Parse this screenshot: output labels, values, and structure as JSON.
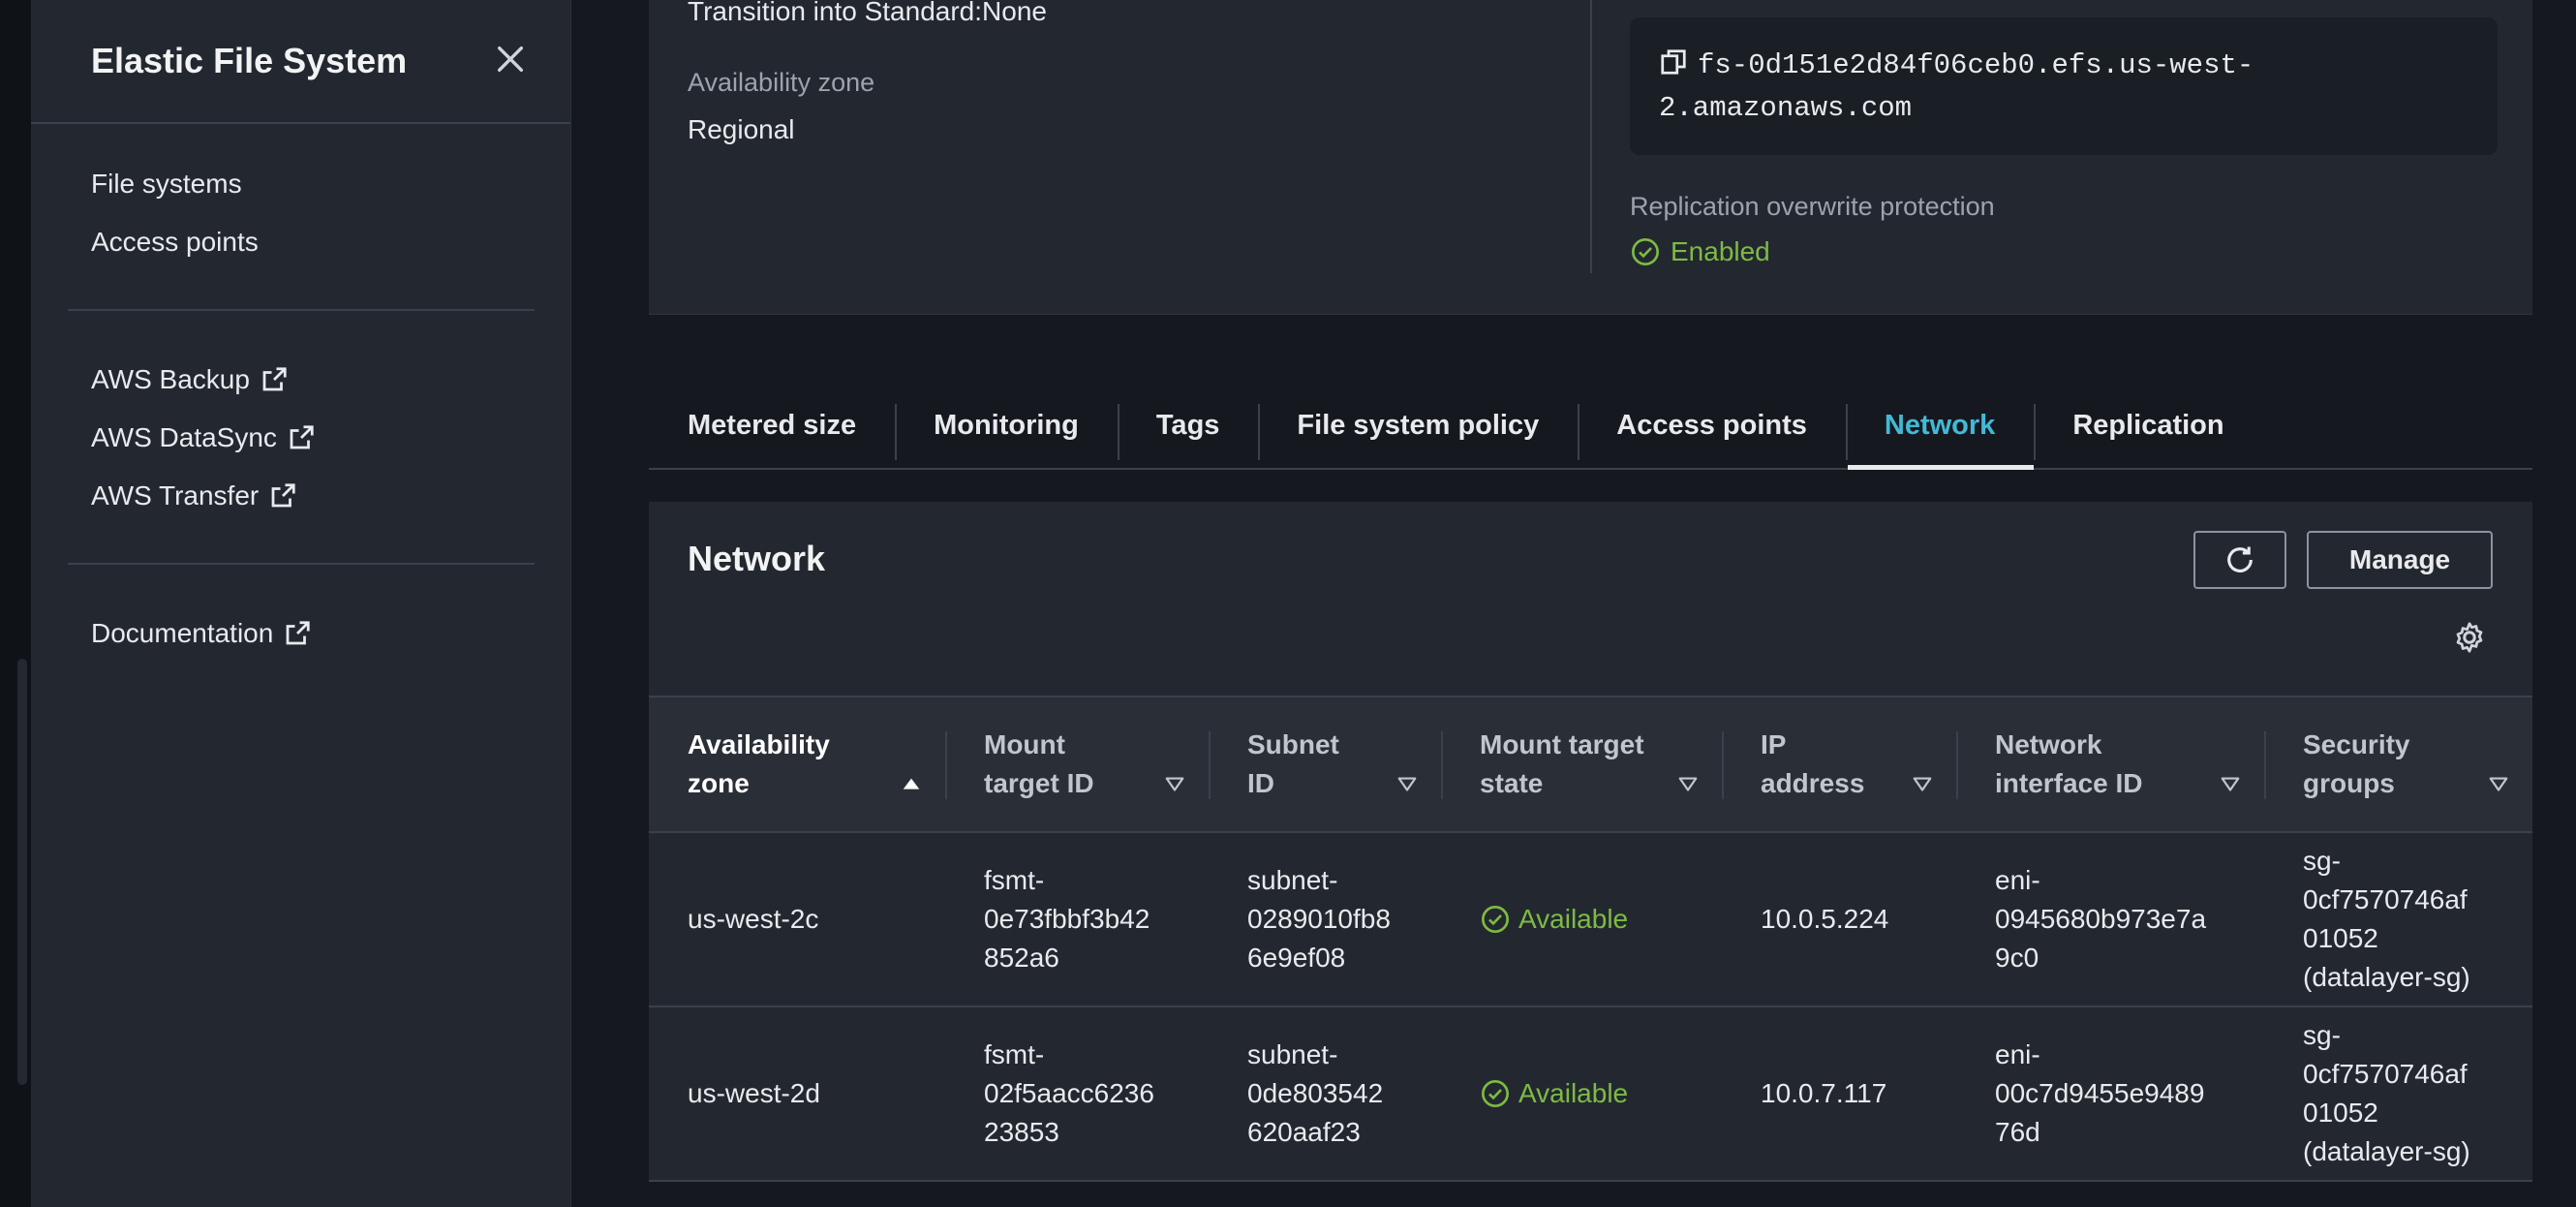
{
  "sidebar": {
    "title": "Elastic File System",
    "nav": [
      {
        "label": "File systems"
      },
      {
        "label": "Access points"
      }
    ],
    "external": [
      {
        "label": "AWS Backup"
      },
      {
        "label": "AWS DataSync"
      },
      {
        "label": "AWS Transfer"
      }
    ],
    "docs": {
      "label": "Documentation"
    }
  },
  "details": {
    "transition_label": "Transition into Standard:",
    "transition_value": "None",
    "az_label": "Availability zone",
    "az_value": "Regional",
    "dns_line1": "fs-0d151e2d84f06ceb0.efs.us-west-",
    "dns_line2": "2.amazonaws.com",
    "replication_label": "Replication overwrite protection",
    "replication_value": "Enabled",
    "status_color": "#7dbb43"
  },
  "tabs": [
    {
      "label": "Metered size"
    },
    {
      "label": "Monitoring"
    },
    {
      "label": "Tags"
    },
    {
      "label": "File system policy"
    },
    {
      "label": "Access points"
    },
    {
      "label": "Network",
      "active": true
    },
    {
      "label": "Replication"
    }
  ],
  "network": {
    "title": "Network",
    "refresh_icon": "refresh-icon",
    "manage_label": "Manage",
    "columns": [
      {
        "line1": "Availability",
        "line2": "zone"
      },
      {
        "line1": "Mount",
        "line2": "target ID"
      },
      {
        "line1": "Subnet",
        "line2": "ID"
      },
      {
        "line1": "Mount target",
        "line2": "state"
      },
      {
        "line1": "IP",
        "line2": "address"
      },
      {
        "line1": "Network",
        "line2": "interface ID"
      },
      {
        "line1": "Security",
        "line2": "groups"
      }
    ],
    "rows": [
      {
        "az": "us-west-2c",
        "mt": [
          "fsmt-",
          "0e73fbbf3b42",
          "852a6"
        ],
        "subnet": [
          "subnet-",
          "0289010fb8",
          "6e9ef08"
        ],
        "state": "Available",
        "ip": "10.0.5.224",
        "eni": [
          "eni-",
          "0945680b973e7a",
          "9c0"
        ],
        "sg": [
          "sg-",
          "0cf7570746af",
          "01052",
          "(datalayer-sg)"
        ]
      },
      {
        "az": "us-west-2d",
        "mt": [
          "fsmt-",
          "02f5aacc6236",
          "23853"
        ],
        "subnet": [
          "subnet-",
          "0de803542",
          "620aaf23"
        ],
        "state": "Available",
        "ip": "10.0.7.117",
        "eni": [
          "eni-",
          "00c7d9455e9489",
          "76d"
        ],
        "sg": [
          "sg-",
          "0cf7570746af",
          "01052",
          "(datalayer-sg)"
        ]
      }
    ]
  }
}
